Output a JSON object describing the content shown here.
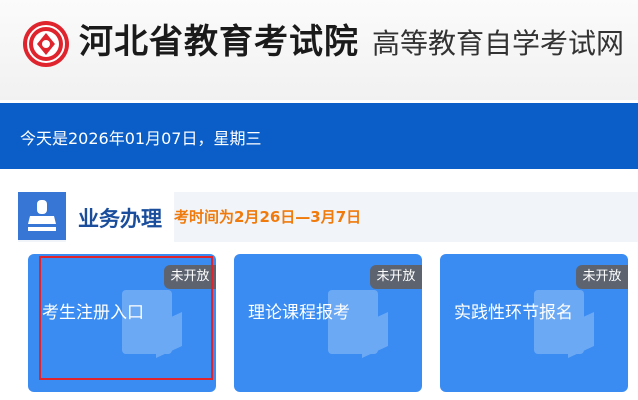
{
  "header": {
    "site_name": "河北省教育考试院",
    "sub_name": "高等教育自学考试网"
  },
  "date_bar": {
    "text": "今天是2026年01月07日，星期三"
  },
  "section": {
    "title": "业务办理",
    "notice": "考时间为2月26日—3月7日"
  },
  "cards": [
    {
      "label": "考生注册入口",
      "badge": "未开放"
    },
    {
      "label": "理论课程报考",
      "badge": "未开放"
    },
    {
      "label": "实践性环节报名",
      "badge": "未开放"
    }
  ],
  "colors": {
    "brand_blue": "#0b5ec8",
    "card_blue": "#3a8cf2",
    "notice_orange": "#f07a0c",
    "logo_red": "#e0242e"
  },
  "icons": {
    "logo": "examination-seal-icon",
    "section": "stamp-icon"
  }
}
